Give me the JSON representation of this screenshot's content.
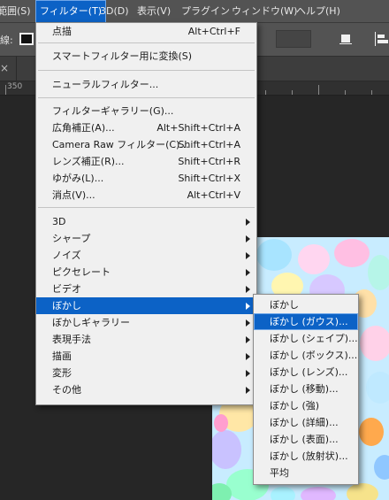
{
  "menubar": {
    "items": [
      {
        "label": "範囲(S)"
      },
      {
        "label": "フィルター(T)"
      },
      {
        "label": "3D(D)"
      },
      {
        "label": "表示(V)"
      },
      {
        "label": "プラグイン"
      },
      {
        "label": "ウィンドウ(W)"
      },
      {
        "label": "ヘルプ(H)"
      }
    ]
  },
  "optionsbar": {
    "stroke_label": "線:"
  },
  "ruler": {
    "tick_label": "350"
  },
  "tab": {
    "close_glyph": "×"
  },
  "filter_menu": {
    "items": [
      {
        "label": "点描",
        "shortcut": "Alt+Ctrl+F"
      },
      {
        "label": "スマートフィルター用に変換(S)",
        "shortcut": ""
      },
      {
        "label": "ニューラルフィルター...",
        "shortcut": ""
      },
      {
        "label": "フィルターギャラリー(G)...",
        "shortcut": ""
      },
      {
        "label": "広角補正(A)...",
        "shortcut": "Alt+Shift+Ctrl+A"
      },
      {
        "label": "Camera Raw フィルター(C)...",
        "shortcut": "Shift+Ctrl+A"
      },
      {
        "label": "レンズ補正(R)...",
        "shortcut": "Shift+Ctrl+R"
      },
      {
        "label": "ゆがみ(L)...",
        "shortcut": "Shift+Ctrl+X"
      },
      {
        "label": "消点(V)...",
        "shortcut": "Alt+Ctrl+V"
      },
      {
        "label": "3D",
        "shortcut": ""
      },
      {
        "label": "シャープ",
        "shortcut": ""
      },
      {
        "label": "ノイズ",
        "shortcut": ""
      },
      {
        "label": "ピクセレート",
        "shortcut": ""
      },
      {
        "label": "ビデオ",
        "shortcut": ""
      },
      {
        "label": "ぼかし",
        "shortcut": ""
      },
      {
        "label": "ぼかしギャラリー",
        "shortcut": ""
      },
      {
        "label": "表現手法",
        "shortcut": ""
      },
      {
        "label": "描画",
        "shortcut": ""
      },
      {
        "label": "変形",
        "shortcut": ""
      },
      {
        "label": "その他",
        "shortcut": ""
      }
    ]
  },
  "blur_submenu": {
    "items": [
      {
        "label": "ぼかし"
      },
      {
        "label": "ぼかし (ガウス)..."
      },
      {
        "label": "ぼかし (シェイプ)..."
      },
      {
        "label": "ぼかし (ボックス)..."
      },
      {
        "label": "ぼかし (レンズ)..."
      },
      {
        "label": "ぼかし (移動)..."
      },
      {
        "label": "ぼかし (強)"
      },
      {
        "label": "ぼかし (詳細)..."
      },
      {
        "label": "ぼかし (表面)..."
      },
      {
        "label": "ぼかし (放射状)..."
      },
      {
        "label": "平均"
      }
    ]
  },
  "colors": {
    "highlight": "#0c62c6",
    "menu_bg": "#f0f0f0",
    "chrome": "#535353",
    "workspace": "#262626"
  }
}
